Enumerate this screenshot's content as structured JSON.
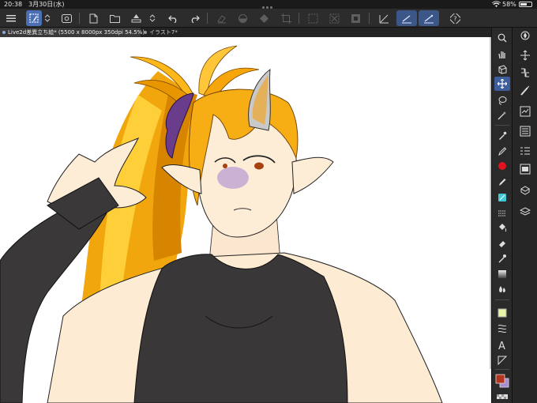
{
  "status_bar": {
    "time": "20:38",
    "date": "3月30日(水)",
    "battery": "58%",
    "battery_level": 0.58
  },
  "toolbar": {
    "items": [
      "menu-icon",
      "select-layer-icon",
      "chevron-updown-icon",
      "screen-icon",
      "new-file-icon",
      "open-folder-icon",
      "save-icon",
      "undo-icon",
      "redo-icon",
      "clear-icon",
      "fill-icon",
      "transform-icon",
      "crop-icon",
      "select-all-icon",
      "deselect-icon",
      "invert-icon",
      "snap-off-icon",
      "snap-ruler-icon",
      "snap-grid-icon",
      "help-icon"
    ]
  },
  "tabs": [
    {
      "label": "Live2d差異立ち絵* (5500 x 8000px 350dpi 54.5%)",
      "active": true
    },
    {
      "label": "イラスト7*",
      "active": false
    }
  ],
  "colors": {
    "accent": "#4b6fb4",
    "main_color": "#b5341f",
    "sub_color": "#a88ad0",
    "fill_red": "#e1131d",
    "fill_cyan": "#43c7d7",
    "light_green": "#e9f3a6"
  }
}
